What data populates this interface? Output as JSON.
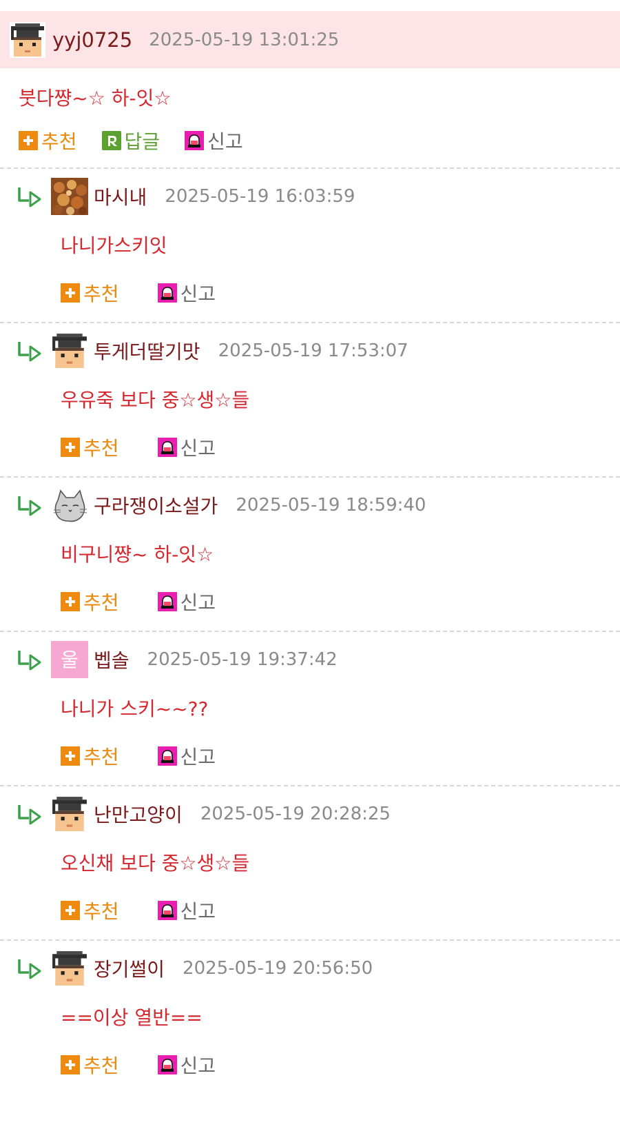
{
  "main_comment": {
    "author": "yyj0725",
    "timestamp": "2025-05-19 13:01:25",
    "body": "붓다쨩~☆ 하-잇☆",
    "actions": {
      "recommend": "추천",
      "reply": "답글",
      "report": "신고"
    },
    "icons": {
      "avatar": "pixel-student-cap-avatar",
      "recommend": "plus-icon",
      "reply": "r-icon",
      "report": "siren-icon"
    }
  },
  "replies": [
    {
      "author": "마시내",
      "timestamp": "2025-05-19 16:03:59",
      "body": "나니가스키잇",
      "avatar": "photo-avatar",
      "recommend": "추천",
      "report": "신고"
    },
    {
      "author": "투게더딸기맛",
      "timestamp": "2025-05-19 17:53:07",
      "body": "우유죽 보다 중☆생☆들",
      "avatar": "pixel-student-cap-avatar",
      "recommend": "추천",
      "report": "신고"
    },
    {
      "author": "구라쟁이소설가",
      "timestamp": "2025-05-19 18:59:40",
      "body": "비구니쨩~ 하-잇☆",
      "avatar": "cat-sketch-avatar",
      "recommend": "추천",
      "report": "신고"
    },
    {
      "author": "벱솔",
      "timestamp": "2025-05-19 19:37:42",
      "body": "나니가 스키~~??",
      "avatar": "pink-letter-avatar",
      "avatar_text": "울",
      "recommend": "추천",
      "report": "신고"
    },
    {
      "author": "난만고양이",
      "timestamp": "2025-05-19 20:28:25",
      "body": "오신채 보다 중☆생☆들",
      "avatar": "pixel-student-cap-avatar",
      "recommend": "추천",
      "report": "신고"
    },
    {
      "author": "장기썰이",
      "timestamp": "2025-05-19 20:56:50",
      "body": "==이상 열반==",
      "avatar": "pixel-student-cap-avatar",
      "recommend": "추천",
      "report": "신고"
    }
  ],
  "colors": {
    "main_header_bg": "#fde4e6",
    "author": "#7a1a1a",
    "timestamp": "#8a8a8a",
    "comment_text": "#d5272e",
    "recommend": "#e98a0d",
    "reply": "#5fa233",
    "report_icon": "#e91fb0",
    "reply_arrow": "#3aa04a"
  }
}
